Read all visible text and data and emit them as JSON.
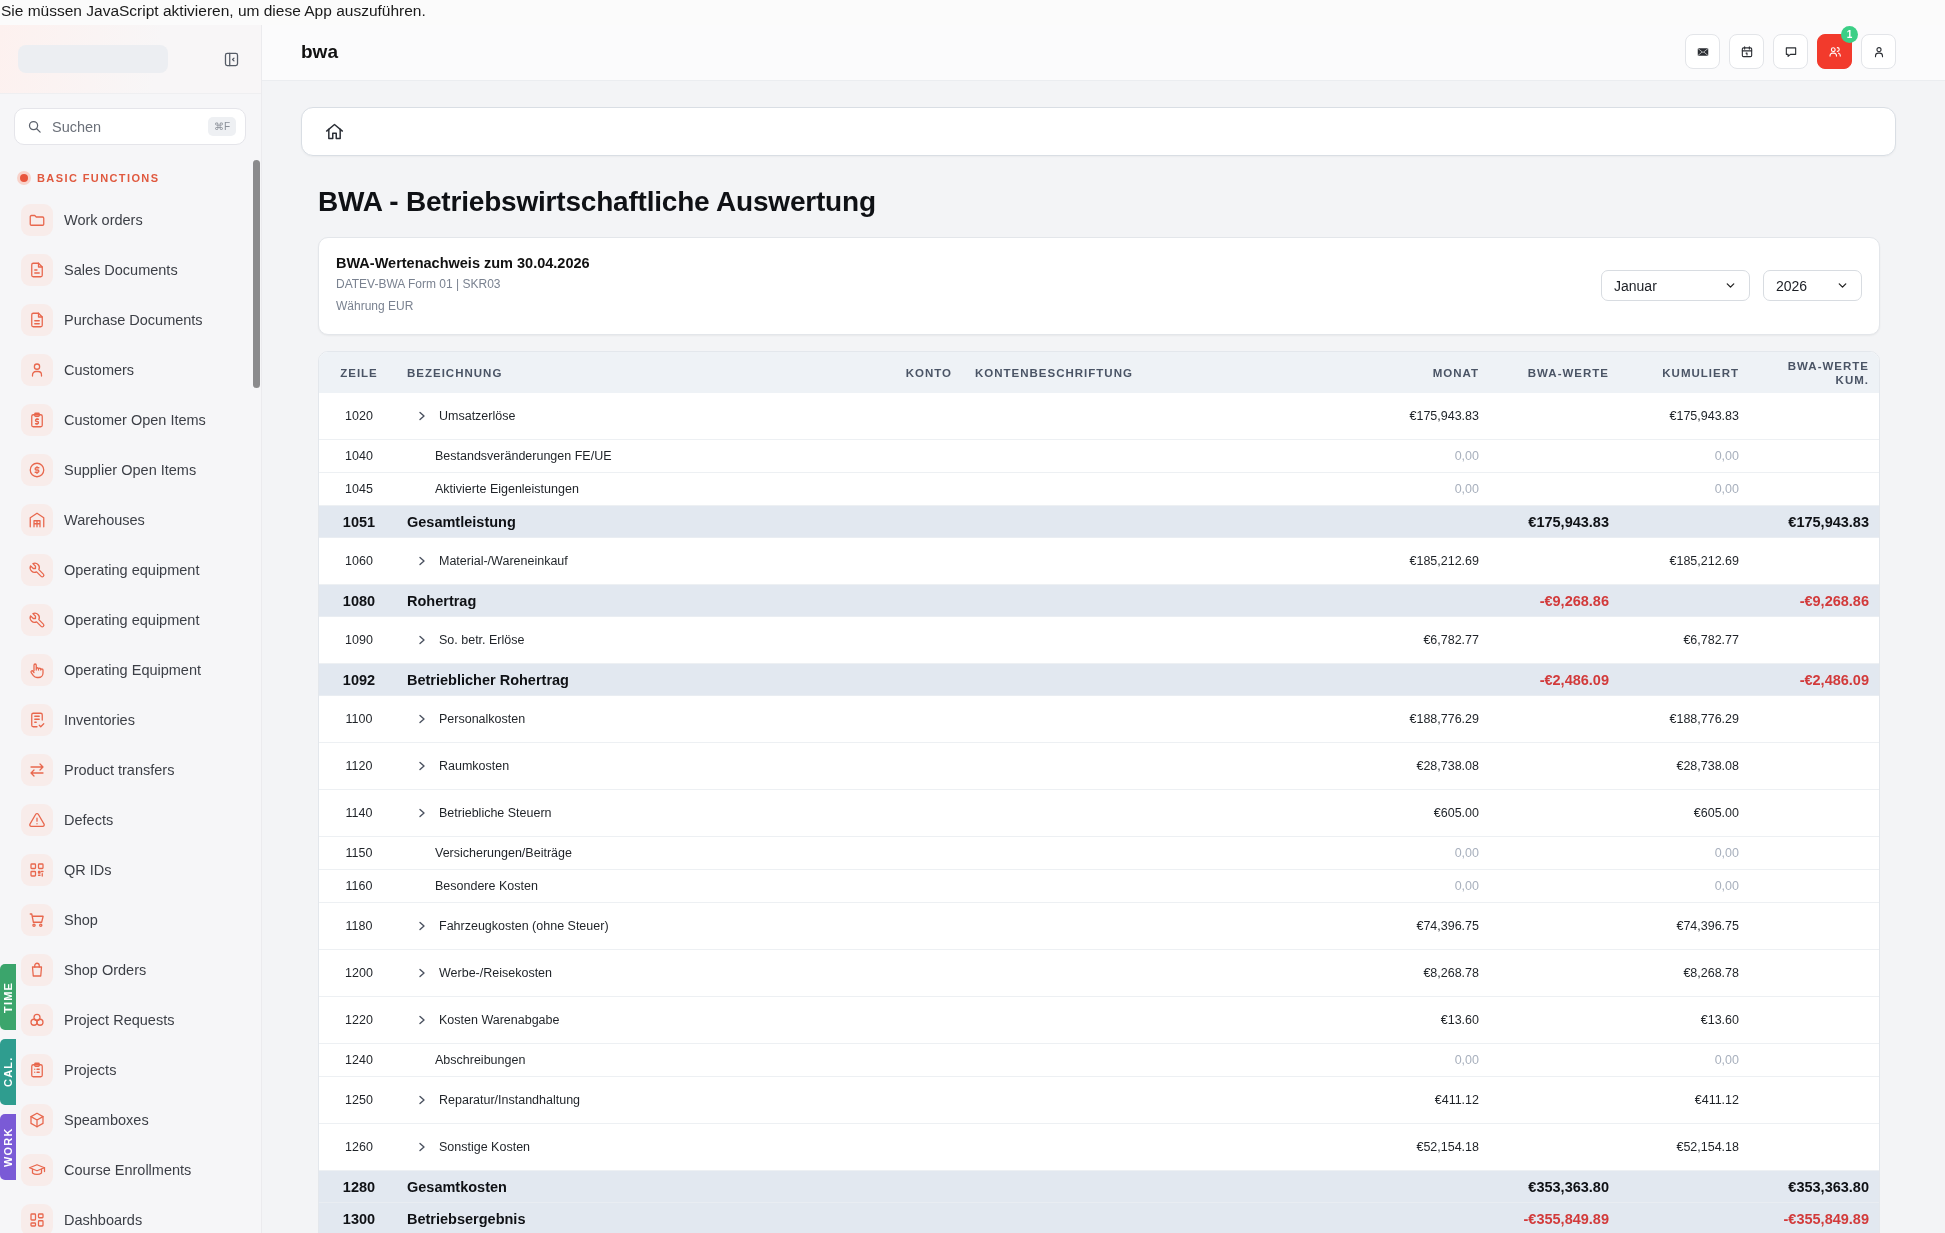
{
  "noscript_notice": "Sie müssen JavaScript aktivieren, um diese App auszuführen.",
  "sidebar": {
    "search": {
      "placeholder": "Suchen",
      "shortcut": "⌘F"
    },
    "section": "BASIC FUNCTIONS",
    "items": [
      {
        "label": "Work orders"
      },
      {
        "label": "Sales Documents"
      },
      {
        "label": "Purchase Documents"
      },
      {
        "label": "Customers"
      },
      {
        "label": "Customer Open Items"
      },
      {
        "label": "Supplier Open Items"
      },
      {
        "label": "Warehouses"
      },
      {
        "label": "Operating equipment"
      },
      {
        "label": "Operating equipment"
      },
      {
        "label": "Operating Equipment"
      },
      {
        "label": "Inventories"
      },
      {
        "label": "Product transfers"
      },
      {
        "label": "Defects"
      },
      {
        "label": "QR IDs"
      },
      {
        "label": "Shop"
      },
      {
        "label": "Shop Orders"
      },
      {
        "label": "Project Requests"
      },
      {
        "label": "Projects"
      },
      {
        "label": "Speamboxes"
      },
      {
        "label": "Course Enrollments"
      },
      {
        "label": "Dashboards"
      }
    ],
    "side_tabs": [
      {
        "label": "TIME",
        "color": "#3ba56c"
      },
      {
        "label": "CAL.",
        "color": "#2f9d8f"
      },
      {
        "label": "WORK",
        "color": "#7a5ad6"
      }
    ]
  },
  "header": {
    "title": "bwa",
    "buttons": [
      {
        "highlighted": false
      },
      {
        "highlighted": false
      },
      {
        "highlighted": false
      },
      {
        "highlighted": true,
        "badge": "1"
      },
      {
        "highlighted": false
      }
    ]
  },
  "page": {
    "title": "BWA - Betriebswirtschaftliche Auswertung",
    "summary": {
      "title": "BWA-Wertenachweis zum 30.04.2026",
      "lines": [
        "DATEV-BWA Form 01 | SKR03",
        "Währung EUR"
      ],
      "month": "Januar",
      "year": "2026"
    }
  },
  "table": {
    "columns": [
      "ZEILE",
      "BEZEICHNUNG",
      "KONTO",
      "KONTENBESCHRIFTUNG",
      "MONAT",
      "BWA-WERTE",
      "KUMULIERT",
      "BWA-WERTE KUM."
    ],
    "rows": [
      {
        "zeile": "1020",
        "bezeichnung": "Umsatzerlöse",
        "kind": "group",
        "expanded": false,
        "zero": false,
        "negative": false,
        "monat": "€175,943.83",
        "kumuliert": "€175,943.83"
      },
      {
        "zeile": "1040",
        "bezeichnung": "Bestandsveränderungen FE/UE",
        "kind": "line",
        "zero": true,
        "negative": false,
        "monat": "0,00",
        "kumuliert": "0,00"
      },
      {
        "zeile": "1045",
        "bezeichnung": "Aktivierte Eigenleistungen",
        "kind": "line",
        "zero": true,
        "negative": false,
        "monat": "0,00",
        "kumuliert": "0,00"
      },
      {
        "zeile": "1051",
        "bezeichnung": "Gesamtleistung",
        "kind": "total",
        "zero": false,
        "negative": false,
        "bwa_werte": "€175,943.83",
        "bwa_werte_kum": "€175,943.83"
      },
      {
        "zeile": "1060",
        "bezeichnung": "Material-/Wareneinkauf",
        "kind": "group",
        "expanded": false,
        "zero": false,
        "negative": false,
        "monat": "€185,212.69",
        "kumuliert": "€185,212.69"
      },
      {
        "zeile": "1080",
        "bezeichnung": "Rohertrag",
        "kind": "total",
        "zero": false,
        "negative": true,
        "bwa_werte": "-€9,268.86",
        "bwa_werte_kum": "-€9,268.86"
      },
      {
        "zeile": "1090",
        "bezeichnung": "So. betr. Erlöse",
        "kind": "group",
        "expanded": false,
        "zero": false,
        "negative": false,
        "monat": "€6,782.77",
        "kumuliert": "€6,782.77"
      },
      {
        "zeile": "1092",
        "bezeichnung": "Betrieblicher Rohertrag",
        "kind": "total",
        "zero": false,
        "negative": true,
        "bwa_werte": "-€2,486.09",
        "bwa_werte_kum": "-€2,486.09"
      },
      {
        "zeile": "1100",
        "bezeichnung": "Personalkosten",
        "kind": "group",
        "expanded": false,
        "zero": false,
        "negative": false,
        "monat": "€188,776.29",
        "kumuliert": "€188,776.29"
      },
      {
        "zeile": "1120",
        "bezeichnung": "Raumkosten",
        "kind": "group",
        "expanded": false,
        "zero": false,
        "negative": false,
        "monat": "€28,738.08",
        "kumuliert": "€28,738.08"
      },
      {
        "zeile": "1140",
        "bezeichnung": "Betriebliche Steuern",
        "kind": "group",
        "expanded": false,
        "zero": false,
        "negative": false,
        "monat": "€605.00",
        "kumuliert": "€605.00"
      },
      {
        "zeile": "1150",
        "bezeichnung": "Versicherungen/Beiträge",
        "kind": "line",
        "zero": true,
        "negative": false,
        "monat": "0,00",
        "kumuliert": "0,00"
      },
      {
        "zeile": "1160",
        "bezeichnung": "Besondere Kosten",
        "kind": "line",
        "zero": true,
        "negative": false,
        "monat": "0,00",
        "kumuliert": "0,00"
      },
      {
        "zeile": "1180",
        "bezeichnung": "Fahrzeugkosten (ohne Steuer)",
        "kind": "group",
        "expanded": false,
        "zero": false,
        "negative": false,
        "monat": "€74,396.75",
        "kumuliert": "€74,396.75"
      },
      {
        "zeile": "1200",
        "bezeichnung": "Werbe-/Reisekosten",
        "kind": "group",
        "expanded": false,
        "zero": false,
        "negative": false,
        "monat": "€8,268.78",
        "kumuliert": "€8,268.78"
      },
      {
        "zeile": "1220",
        "bezeichnung": "Kosten Warenabgabe",
        "kind": "group",
        "expanded": false,
        "zero": false,
        "negative": false,
        "monat": "€13.60",
        "kumuliert": "€13.60"
      },
      {
        "zeile": "1240",
        "bezeichnung": "Abschreibungen",
        "kind": "line",
        "zero": true,
        "negative": false,
        "monat": "0,00",
        "kumuliert": "0,00"
      },
      {
        "zeile": "1250",
        "bezeichnung": "Reparatur/Instandhaltung",
        "kind": "group",
        "expanded": false,
        "zero": false,
        "negative": false,
        "monat": "€411.12",
        "kumuliert": "€411.12"
      },
      {
        "zeile": "1260",
        "bezeichnung": "Sonstige Kosten",
        "kind": "group",
        "expanded": false,
        "zero": false,
        "negative": false,
        "monat": "€52,154.18",
        "kumuliert": "€52,154.18"
      },
      {
        "zeile": "1280",
        "bezeichnung": "Gesamtkosten",
        "kind": "total",
        "zero": false,
        "negative": false,
        "bwa_werte": "€353,363.80",
        "bwa_werte_kum": "€353,363.80"
      },
      {
        "zeile": "1300",
        "bezeichnung": "Betriebsergebnis",
        "kind": "total",
        "zero": false,
        "negative": true,
        "bwa_werte": "-€355,849.89",
        "bwa_werte_kum": "-€355,849.89"
      }
    ]
  }
}
